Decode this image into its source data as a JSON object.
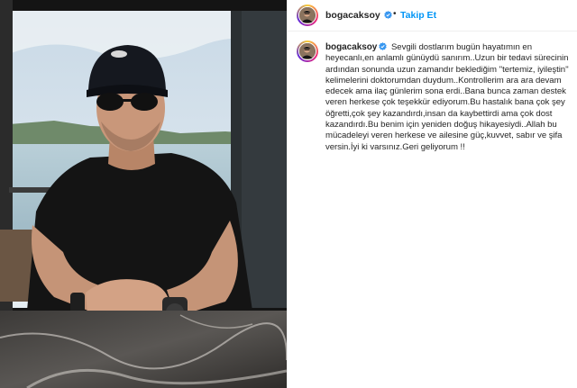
{
  "post": {
    "username": "bogacaksoy",
    "follow_label": "Takip Et",
    "separator": "•",
    "caption": "Sevgili dostlarım bugün hayatımın en heyecanlı,en anlamlı günüydü sanırım..Uzun bir tedavi sürecinin ardından sonunda uzun zamandır beklediğim ''tertemiz, iyileştin'' kelimelerini doktorumdan duydum..Kontrollerim ara ara devam edecek ama ilaç günlerim sona erdi..Bana bunca zaman destek veren herkese çok teşekkür ediyorum.Bu hastalık bana çok şey öğretti,çok şey kazandırdı,insan da kaybettirdi ama çok dost kazandırdı.Bu benim için yeniden doğuş hikayesiydi..Allah bu mücadeleyi veren herkese ve ailesine güç,kuvvet, sabır ve şifa versin.İyi ki varsınız.Geri geliyorum !!"
  },
  "icons": {
    "verified": "verified-badge-icon",
    "avatar": "profile-avatar"
  },
  "colors": {
    "follow": "#0095f6",
    "verified": "#3897f0",
    "text": "#262626"
  }
}
